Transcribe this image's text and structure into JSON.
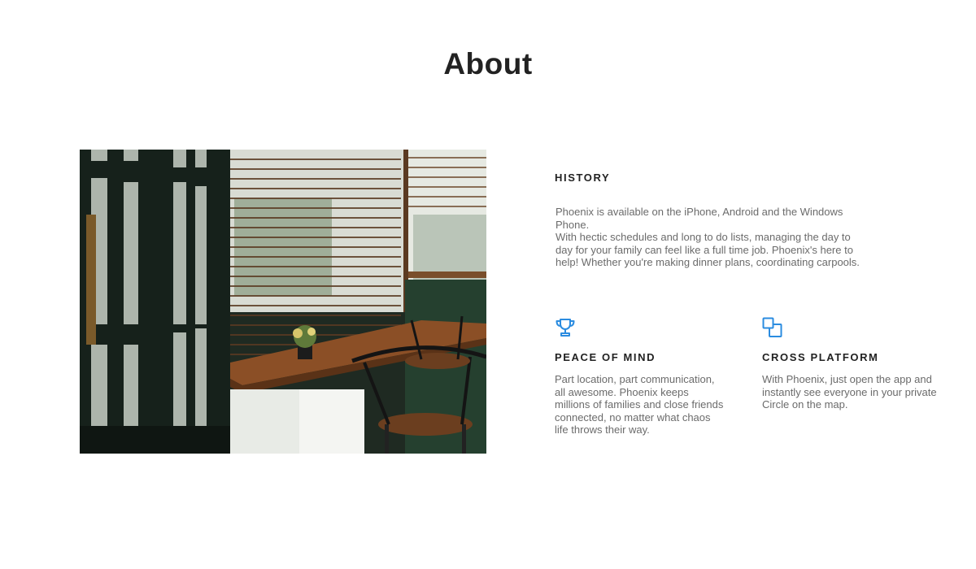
{
  "page": {
    "title": "About"
  },
  "photo": {
    "description_icon": "cafe-window-photo"
  },
  "history": {
    "heading": "HISTORY",
    "paragraph_1": "Phoenix is available on the iPhone, Android and the Windows Phone.",
    "paragraph_2": "With hectic schedules and long to do lists, managing the day to day for your family can feel like a full time job. Phoenix's here to help! Whether you're making dinner plans, coordinating carpools."
  },
  "features": [
    {
      "icon": "trophy-icon",
      "heading": "PEACE OF MIND",
      "text": "Part location, part communication, all awesome. Phoenix keeps millions of families and close friends connected, no matter what chaos life throws their way."
    },
    {
      "icon": "cross-platform-icon",
      "heading": "CROSS PLATFORM",
      "text": "With Phoenix, just open the app and instantly see everyone in your private Circle on the map."
    }
  ],
  "colors": {
    "accent": "#2b8ce0",
    "heading": "#222222",
    "body_text": "#6b6b6b",
    "background": "#ffffff"
  }
}
